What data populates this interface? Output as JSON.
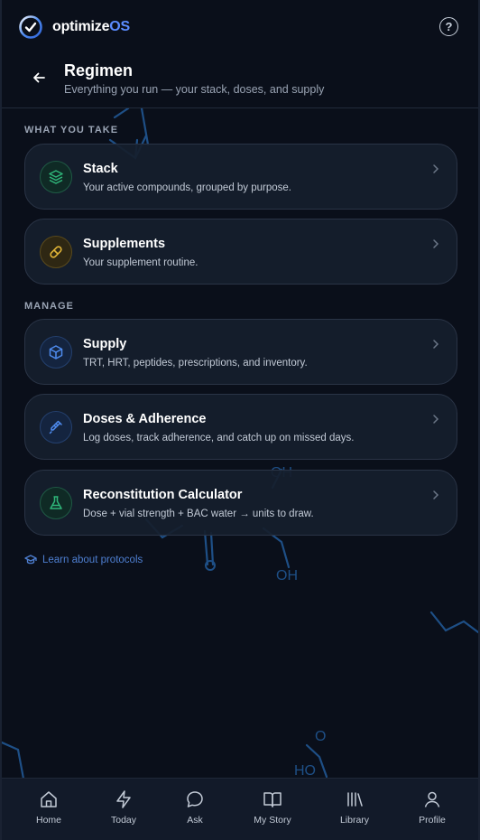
{
  "brand": {
    "name_part1": "optimize",
    "name_part2": "OS"
  },
  "help_symbol": "?",
  "header": {
    "title": "Regimen",
    "subtitle": "Everything you run — your stack, doses, and supply"
  },
  "sections": {
    "what_you_take": "WHAT YOU TAKE",
    "manage": "MANAGE"
  },
  "cards": [
    {
      "title": "Stack",
      "description": "Your active compounds, grouped by purpose.",
      "icon": "layers-icon",
      "color": "#2fb67a"
    },
    {
      "title": "Supplements",
      "description": "Your supplement routine.",
      "icon": "pill-icon",
      "color": "#e0b437"
    },
    {
      "title": "Supply",
      "description": "TRT, HRT, peptides, prescriptions, and inventory.",
      "icon": "box-icon",
      "color": "#4f8cf0"
    },
    {
      "title": "Doses & Adherence",
      "description": "Log doses, track adherence, and catch up on missed days.",
      "icon": "syringe-icon",
      "color": "#4f8cf0"
    },
    {
      "title": "Reconstitution Calculator",
      "description": "Dose + vial strength + BAC water → units to draw.",
      "icon": "flask-icon",
      "color": "#2fb67a"
    }
  ],
  "learn_link": "Learn about protocols",
  "nav": [
    {
      "label": "Home",
      "icon": "home-icon"
    },
    {
      "label": "Today",
      "icon": "bolt-icon"
    },
    {
      "label": "Ask",
      "icon": "chat-icon"
    },
    {
      "label": "My Story",
      "icon": "book-icon"
    },
    {
      "label": "Library",
      "icon": "library-icon"
    },
    {
      "label": "Profile",
      "icon": "user-icon"
    }
  ],
  "molecule_labels": {
    "oh1": "OH",
    "oh2": "OH",
    "o": "O",
    "ho": "HO"
  },
  "colors": {
    "accent": "#5b8cff",
    "background": "#0a0f1a",
    "card": "#161e2c"
  }
}
